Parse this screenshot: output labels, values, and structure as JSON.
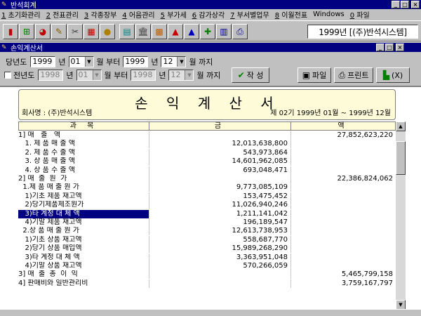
{
  "app_title": "반석회계",
  "menu": [
    {
      "key": "1",
      "label": " 초기화관리"
    },
    {
      "key": "2",
      "label": " 전표관리"
    },
    {
      "key": "3",
      "label": " 각종장부"
    },
    {
      "key": "4",
      "label": " 어음관리"
    },
    {
      "key": "5",
      "label": " 부가세"
    },
    {
      "key": "6",
      "label": " 감가상각"
    },
    {
      "key": "7",
      "label": " 부서별업무"
    },
    {
      "key": "8",
      "label": " 이월전표"
    },
    {
      "key": "",
      "label": "Windows"
    },
    {
      "key": "0",
      "label": " 파일"
    }
  ],
  "toolbar": {
    "icons": [
      "exit-icon",
      "tree-icon",
      "chart-icon",
      "pencil-icon",
      "tools-icon",
      "calculator-icon",
      "coin-icon",
      "book-icon",
      "bank-icon",
      "grid-icon",
      "arrow-up-red-icon",
      "arrow-up-blue-icon",
      "cross-icon",
      "table-icon",
      "printer-icon"
    ],
    "year_display": "1999년 [(주)반석시스템]"
  },
  "window_title": "손익계산서",
  "filter": {
    "current_label": "당년도",
    "current_year_from": "1999",
    "year_unit": "년",
    "current_month_from": "01",
    "month_from_unit": "월 부터",
    "current_year_to": "1999",
    "current_month_to": "12",
    "month_to_unit": "월 까지",
    "prior_label": "전년도",
    "prior_year_from": "1998",
    "prior_month_from": "01",
    "prior_year_to": "1998",
    "prior_month_to": "12",
    "create_button": "작 성",
    "file_button": "파일",
    "print_button": "프린트",
    "exit_button": "(X)"
  },
  "report": {
    "title": "손 익 계 산 서",
    "company": "회사명 : (주)반석시스템",
    "period": "제 02기 1999년 01월 ~ 1999년 12월",
    "columns": [
      "과  목",
      "금",
      "액"
    ],
    "rows": [
      {
        "name": "1] 매   출   액",
        "amt1": "",
        "amt2": "27,852,623,220"
      },
      {
        "name": "   1. 제 품 매 출 액",
        "amt1": "12,013,638,800",
        "amt2": ""
      },
      {
        "name": "   2. 제 품 수 출 액",
        "amt1": "543,973,864",
        "amt2": ""
      },
      {
        "name": "   3. 상 품 매 출 액",
        "amt1": "14,601,962,085",
        "amt2": ""
      },
      {
        "name": "   4. 상 품 수 출 액",
        "amt1": "693,048,471",
        "amt2": ""
      },
      {
        "name": "2] 매  출  원  가",
        "amt1": "",
        "amt2": "22,386,824,062"
      },
      {
        "name": "  1.제 품 매 출 원 가",
        "amt1": "9,773,085,109",
        "amt2": ""
      },
      {
        "name": "   1)기초 제품 재고액",
        "amt1": "153,475,452",
        "amt2": ""
      },
      {
        "name": "   2)당기제품제조원가",
        "amt1": "11,026,940,246",
        "amt2": ""
      },
      {
        "name": "   3)타 계정 대 체 액",
        "amt1": "1,211,141,042",
        "amt2": "",
        "selected": true
      },
      {
        "name": "   4)기말 제품 재고액",
        "amt1": "196,189,547",
        "amt2": ""
      },
      {
        "name": "  2.상 품 매 출 원 가",
        "amt1": "12,613,738,953",
        "amt2": ""
      },
      {
        "name": "   1)기초 상품 재고액",
        "amt1": "558,687,770",
        "amt2": ""
      },
      {
        "name": "   2)당기 상품 매입액",
        "amt1": "15,989,268,290",
        "amt2": ""
      },
      {
        "name": "   3)타 계정 대 체 액",
        "amt1": "3,363,951,048",
        "amt2": ""
      },
      {
        "name": "   4)기말 상품 재고액",
        "amt1": "570,266,059",
        "amt2": ""
      },
      {
        "name": "3] 매  출  총  이  익",
        "amt1": "",
        "amt2": "5,465,799,158"
      },
      {
        "name": "4] 판매비와 일반관리비",
        "amt1": "",
        "amt2": "3,759,167,797"
      }
    ]
  }
}
